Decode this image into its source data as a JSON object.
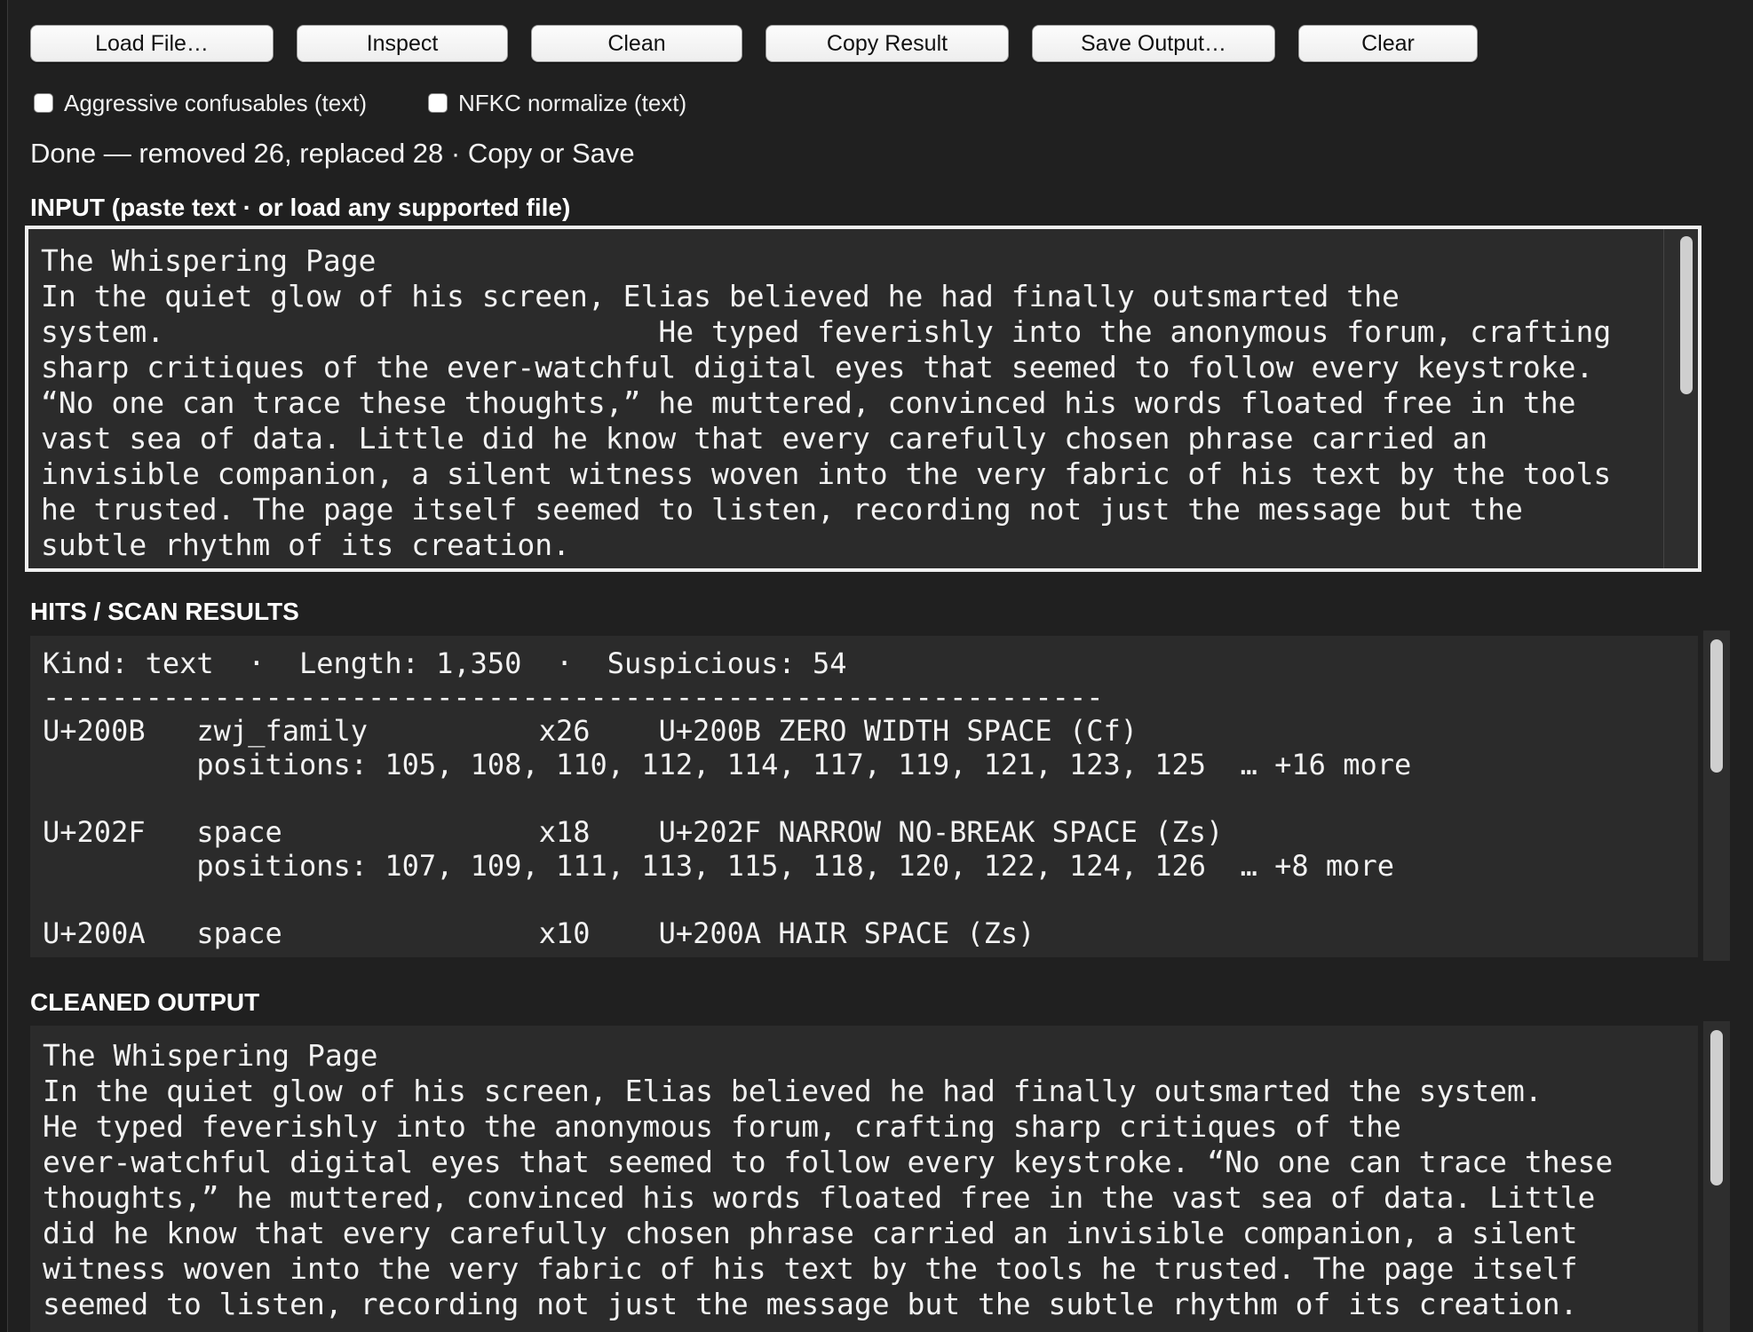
{
  "toolbar": {
    "load_file": "Load File…",
    "inspect": "Inspect",
    "clean": "Clean",
    "copy_result": "Copy Result",
    "save_output": "Save Output…",
    "clear": "Clear"
  },
  "options": {
    "aggressive_confusables": "Aggressive confusables (text)",
    "nfkc_normalize": "NFKC normalize (text)"
  },
  "status": {
    "text": "Done — removed 26, replaced 28  ·  Copy or Save"
  },
  "input": {
    "label": "INPUT  (paste text  ·  or load any supported file)",
    "text": "The Whispering Page\nIn the quiet glow of his screen, Elias believed he had finally outsmarted the\nsystem.                            He typed feverishly into the anonymous forum, crafting\nsharp critiques of the ever-watchful digital eyes that seemed to follow every keystroke.\n“No one can trace these thoughts,” he muttered, convinced his words floated free in the\nvast sea of data. Little did he know that every carefully chosen phrase carried an\ninvisible companion, a silent witness woven into the very fabric of his text by the tools\nhe trusted. The page itself seemed to listen, recording not just the message but the\nsubtle rhythm of its creation."
  },
  "hits": {
    "label": "HITS / SCAN RESULTS",
    "text": "Kind: text  ·  Length: 1,350  ·  Suspicious: 54\n--------------------------------------------------------------\nU+200B   zwj_family          x26    U+200B ZERO WIDTH SPACE (Cf)\n         positions: 105, 108, 110, 112, 114, 117, 119, 121, 123, 125  … +16 more\n\nU+202F   space               x18    U+202F NARROW NO-BREAK SPACE (Zs)\n         positions: 107, 109, 111, 113, 115, 118, 120, 122, 124, 126  … +8 more\n\nU+200A   space               x10    U+200A HAIR SPACE (Zs)"
  },
  "output": {
    "label": "CLEANED OUTPUT",
    "text": "The Whispering Page\nIn the quiet glow of his screen, Elias believed he had finally outsmarted the system.\nHe typed feverishly into the anonymous forum, crafting sharp critiques of the\never-watchful digital eyes that seemed to follow every keystroke. “No one can trace these\nthoughts,” he muttered, convinced his words floated free in the vast sea of data. Little\ndid he know that every carefully chosen phrase carried an invisible companion, a silent\nwitness woven into the very fabric of his text by the tools he trusted. The page itself\nseemed to listen, recording not just the message but the subtle rhythm of its creation."
  }
}
